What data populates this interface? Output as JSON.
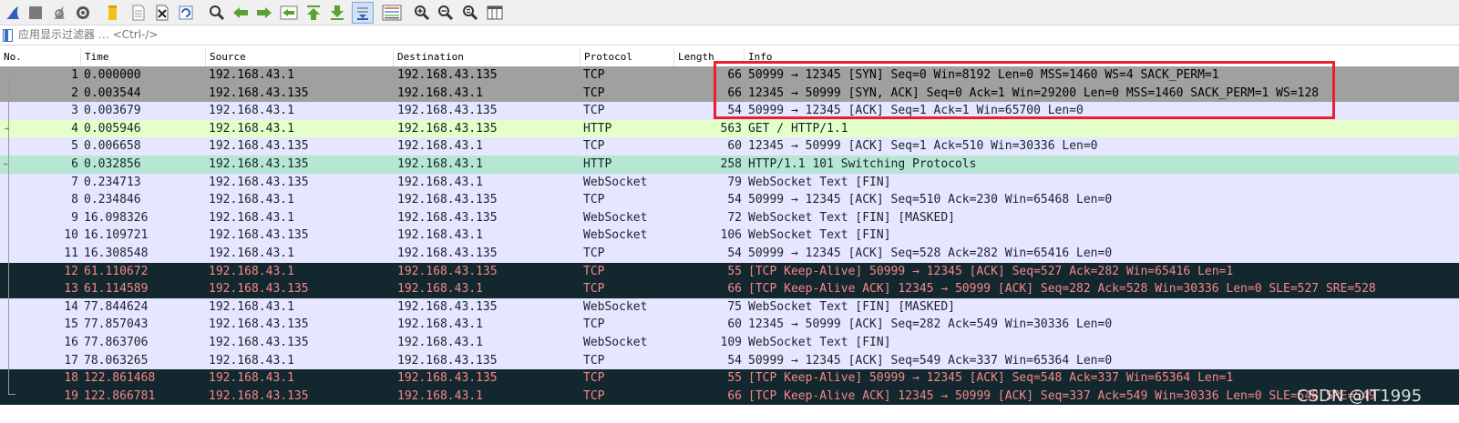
{
  "toolbar": {
    "icons": [
      "shark-fin-start-icon",
      "stop-square-icon",
      "restart-fin-icon",
      "capture-options-gear-icon",
      "open-folder-icon",
      "file-icon",
      "close-file-icon",
      "reload-icon",
      "find-magnifier-icon",
      "go-back-arrow-icon",
      "go-forward-arrow-icon",
      "go-to-packet-icon",
      "go-first-icon",
      "go-last-icon",
      "autoscroll-icon",
      "colorize-icon",
      "zoom-in-icon",
      "zoom-out-icon",
      "zoom-normal-icon",
      "resize-columns-icon"
    ]
  },
  "filter": {
    "placeholder": "应用显示过滤器 … <Ctrl-/>"
  },
  "columns": {
    "no": "No.",
    "time": "Time",
    "source": "Source",
    "destination": "Destination",
    "protocol": "Protocol",
    "length": "Length",
    "info": "Info"
  },
  "packets": [
    {
      "no": "1",
      "time": "0.000000",
      "src": "192.168.43.1",
      "dst": "192.168.43.135",
      "proto": "TCP",
      "len": "66",
      "info": "50999 → 12345 [SYN] Seq=0 Win=8192 Len=0 MSS=1460 WS=4 SACK_PERM=1",
      "style": "sel"
    },
    {
      "no": "2",
      "time": "0.003544",
      "src": "192.168.43.135",
      "dst": "192.168.43.1",
      "proto": "TCP",
      "len": "66",
      "info": "12345 → 50999 [SYN, ACK] Seq=0 Ack=1 Win=29200 Len=0 MSS=1460 SACK_PERM=1 WS=128",
      "style": "sel"
    },
    {
      "no": "3",
      "time": "0.003679",
      "src": "192.168.43.1",
      "dst": "192.168.43.135",
      "proto": "TCP",
      "len": "54",
      "info": "50999 → 12345 [ACK] Seq=1 Ack=1 Win=65700 Len=0",
      "style": "tcp"
    },
    {
      "no": "4",
      "time": "0.005946",
      "src": "192.168.43.1",
      "dst": "192.168.43.135",
      "proto": "HTTP",
      "len": "563",
      "info": "GET / HTTP/1.1",
      "style": "http"
    },
    {
      "no": "5",
      "time": "0.006658",
      "src": "192.168.43.135",
      "dst": "192.168.43.1",
      "proto": "TCP",
      "len": "60",
      "info": "12345 → 50999 [ACK] Seq=1 Ack=510 Win=30336 Len=0",
      "style": "tcp"
    },
    {
      "no": "6",
      "time": "0.032856",
      "src": "192.168.43.135",
      "dst": "192.168.43.1",
      "proto": "HTTP",
      "len": "258",
      "info": "HTTP/1.1 101 Switching Protocols",
      "style": "http-sel"
    },
    {
      "no": "7",
      "time": "0.234713",
      "src": "192.168.43.135",
      "dst": "192.168.43.1",
      "proto": "WebSocket",
      "len": "79",
      "info": "WebSocket Text [FIN]",
      "style": "tcp"
    },
    {
      "no": "8",
      "time": "0.234846",
      "src": "192.168.43.1",
      "dst": "192.168.43.135",
      "proto": "TCP",
      "len": "54",
      "info": "50999 → 12345 [ACK] Seq=510 Ack=230 Win=65468 Len=0",
      "style": "tcp"
    },
    {
      "no": "9",
      "time": "16.098326",
      "src": "192.168.43.1",
      "dst": "192.168.43.135",
      "proto": "WebSocket",
      "len": "72",
      "info": "WebSocket Text [FIN] [MASKED]",
      "style": "tcp"
    },
    {
      "no": "10",
      "time": "16.109721",
      "src": "192.168.43.135",
      "dst": "192.168.43.1",
      "proto": "WebSocket",
      "len": "106",
      "info": "WebSocket Text [FIN]",
      "style": "tcp"
    },
    {
      "no": "11",
      "time": "16.308548",
      "src": "192.168.43.1",
      "dst": "192.168.43.135",
      "proto": "TCP",
      "len": "54",
      "info": "50999 → 12345 [ACK] Seq=528 Ack=282 Win=65416 Len=0",
      "style": "tcp"
    },
    {
      "no": "12",
      "time": "61.110672",
      "src": "192.168.43.1",
      "dst": "192.168.43.135",
      "proto": "TCP",
      "len": "55",
      "info": "[TCP Keep-Alive] 50999 → 12345 [ACK] Seq=527 Ack=282 Win=65416 Len=1",
      "style": "ka"
    },
    {
      "no": "13",
      "time": "61.114589",
      "src": "192.168.43.135",
      "dst": "192.168.43.1",
      "proto": "TCP",
      "len": "66",
      "info": "[TCP Keep-Alive ACK] 12345 → 50999 [ACK] Seq=282 Ack=528 Win=30336 Len=0 SLE=527 SRE=528",
      "style": "ka"
    },
    {
      "no": "14",
      "time": "77.844624",
      "src": "192.168.43.1",
      "dst": "192.168.43.135",
      "proto": "WebSocket",
      "len": "75",
      "info": "WebSocket Text [FIN] [MASKED]",
      "style": "tcp"
    },
    {
      "no": "15",
      "time": "77.857043",
      "src": "192.168.43.135",
      "dst": "192.168.43.1",
      "proto": "TCP",
      "len": "60",
      "info": "12345 → 50999 [ACK] Seq=282 Ack=549 Win=30336 Len=0",
      "style": "tcp"
    },
    {
      "no": "16",
      "time": "77.863706",
      "src": "192.168.43.135",
      "dst": "192.168.43.1",
      "proto": "WebSocket",
      "len": "109",
      "info": "WebSocket Text [FIN]",
      "style": "tcp"
    },
    {
      "no": "17",
      "time": "78.063265",
      "src": "192.168.43.1",
      "dst": "192.168.43.135",
      "proto": "TCP",
      "len": "54",
      "info": "50999 → 12345 [ACK] Seq=549 Ack=337 Win=65364 Len=0",
      "style": "tcp"
    },
    {
      "no": "18",
      "time": "122.861468",
      "src": "192.168.43.1",
      "dst": "192.168.43.135",
      "proto": "TCP",
      "len": "55",
      "info": "[TCP Keep-Alive] 50999 → 12345 [ACK] Seq=548 Ack=337 Win=65364 Len=1",
      "style": "ka"
    },
    {
      "no": "19",
      "time": "122.866781",
      "src": "192.168.43.135",
      "dst": "192.168.43.1",
      "proto": "TCP",
      "len": "66",
      "info": "[TCP Keep-Alive ACK] 12345 → 50999 [ACK] Seq=337 Ack=549 Win=30336 Len=0 SLE=548 SRE=549",
      "style": "ka"
    }
  ],
  "watermark": "CSDN @IT1995",
  "colors": {
    "tcp_row": "#e7e6ff",
    "http_row": "#e4ffc7",
    "keepalive_row_bg": "#12272e",
    "keepalive_row_fg": "#f78787",
    "selected_row": "#a0a0a0",
    "highlight_box": "#e8222a"
  }
}
